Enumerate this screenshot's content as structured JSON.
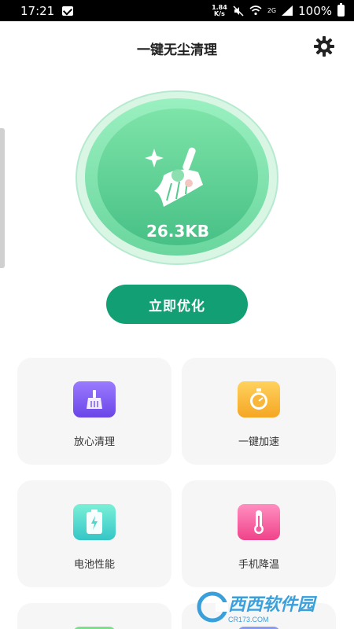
{
  "status_bar": {
    "time": "17:21",
    "net_speed_value": "1.84",
    "net_speed_unit": "K/s",
    "network_type": "2G",
    "battery": "100%"
  },
  "header": {
    "title": "一键无尘清理"
  },
  "cleaner": {
    "junk_size": "26.3KB",
    "optimize_label": "立即优化"
  },
  "features": [
    {
      "label": "放心清理",
      "icon": "broom-icon",
      "color": "#7b5cf5"
    },
    {
      "label": "一键加速",
      "icon": "stopwatch-icon",
      "color": "#f8b73a"
    },
    {
      "label": "电池性能",
      "icon": "battery-icon",
      "color": "#4fd6cf"
    },
    {
      "label": "手机降温",
      "icon": "thermometer-icon",
      "color": "#f45aa0"
    }
  ],
  "colors": {
    "accent": "#139f74",
    "circle": "#6ad69e"
  }
}
